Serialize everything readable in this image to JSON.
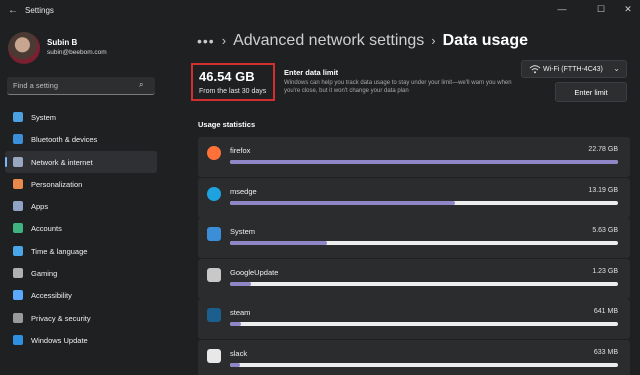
{
  "window": {
    "title": "Settings"
  },
  "profile": {
    "name": "Subin B",
    "email": "subin@beebom.com"
  },
  "search": {
    "placeholder": "Find a setting"
  },
  "sidebar": {
    "items": [
      {
        "label": "System",
        "icon": "monitor-icon",
        "color": "#4ca0e0"
      },
      {
        "label": "Bluetooth & devices",
        "icon": "bluetooth-icon",
        "color": "#3a8fd8"
      },
      {
        "label": "Network & internet",
        "icon": "network-icon",
        "color": "#9aa7c0",
        "active": true
      },
      {
        "label": "Personalization",
        "icon": "brush-icon",
        "color": "#e88a4c"
      },
      {
        "label": "Apps",
        "icon": "apps-icon",
        "color": "#8fa4c4"
      },
      {
        "label": "Accounts",
        "icon": "person-icon",
        "color": "#3fb27f"
      },
      {
        "label": "Time & language",
        "icon": "globe-clock-icon",
        "color": "#4aa6e8"
      },
      {
        "label": "Gaming",
        "icon": "gamepad-icon",
        "color": "#b0b0b0"
      },
      {
        "label": "Accessibility",
        "icon": "accessibility-icon",
        "color": "#5aa8ff"
      },
      {
        "label": "Privacy & security",
        "icon": "shield-icon",
        "color": "#9a9a9a"
      },
      {
        "label": "Windows Update",
        "icon": "update-icon",
        "color": "#2f8fe0"
      }
    ]
  },
  "breadcrumb": {
    "dots": "•••",
    "parent": "Advanced network settings",
    "current": "Data usage"
  },
  "summary": {
    "total": "46.54 GB",
    "period": "From the last 30 days"
  },
  "limit": {
    "title": "Enter data limit",
    "description": "Windows can help you track data usage to stay under your limit—we'll warn you when you're close, but it won't change your data plan",
    "button": "Enter limit"
  },
  "network_select": {
    "value": "Wi-Fi (FTTH-4C43)"
  },
  "usage": {
    "title": "Usage statistics",
    "apps": [
      {
        "name": "firefox",
        "size": "22.78 GB",
        "fraction": 1.0,
        "icon": "firefox-icon",
        "color": "#ff7139"
      },
      {
        "name": "msedge",
        "size": "13.19 GB",
        "fraction": 0.58,
        "icon": "edge-icon",
        "color": "#1fa3e0"
      },
      {
        "name": "System",
        "size": "5.63 GB",
        "fraction": 0.25,
        "icon": "system-icon",
        "color": "#3a8fd8"
      },
      {
        "name": "GoogleUpdate",
        "size": "1.23 GB",
        "fraction": 0.054,
        "icon": "google-update-icon",
        "color": "#c8c8c8"
      },
      {
        "name": "steam",
        "size": "641 MB",
        "fraction": 0.028,
        "icon": "steam-icon",
        "color": "#1b5f8f"
      },
      {
        "name": "slack",
        "size": "633 MB",
        "fraction": 0.027,
        "icon": "slack-icon",
        "color": "#e8e8e8"
      }
    ]
  }
}
